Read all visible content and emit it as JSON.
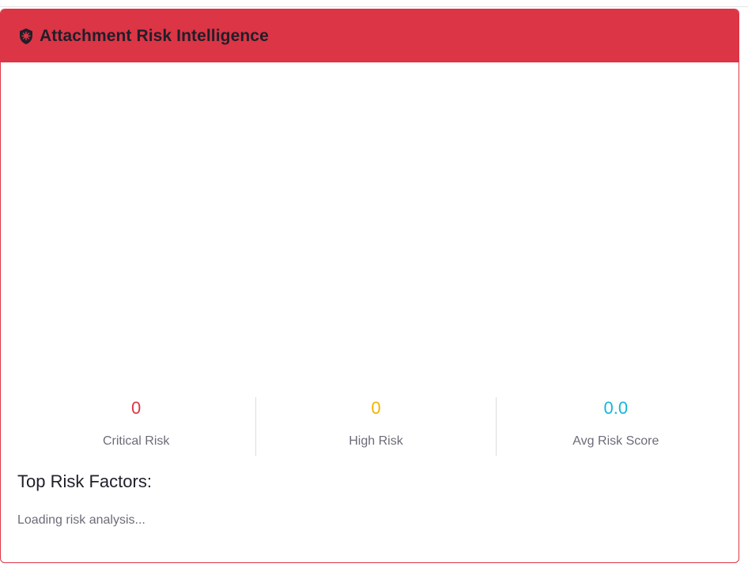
{
  "header": {
    "title": "Attachment Risk Intelligence",
    "icon": "shield-virus-icon",
    "background": "#dc3545"
  },
  "stats": [
    {
      "value": "0",
      "label": "Critical Risk",
      "color": "#dc3545"
    },
    {
      "value": "0",
      "label": "High Risk",
      "color": "#f0b400"
    },
    {
      "value": "0.0",
      "label": "Avg Risk Score",
      "color": "#17b6d8"
    }
  ],
  "factors": {
    "title": "Top Risk Factors:",
    "status": "Loading risk analysis..."
  }
}
